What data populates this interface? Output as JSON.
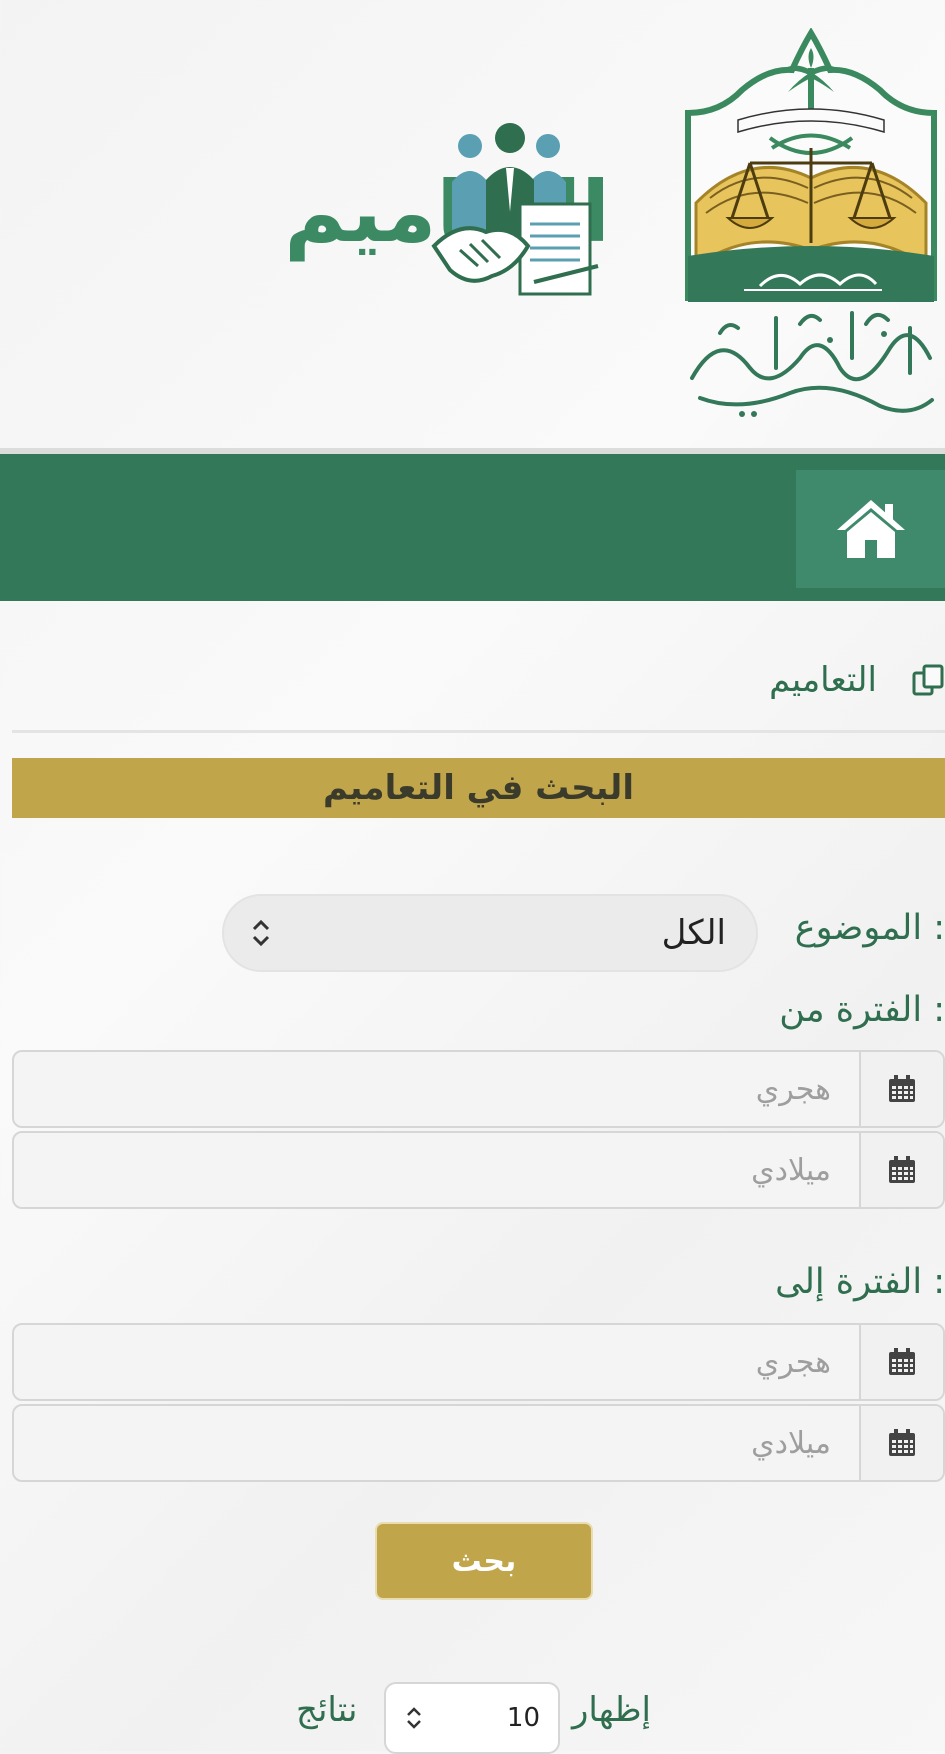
{
  "header": {
    "banner_title": "التعاميم",
    "emblem_alt": "وزارة العدل - مركز البحوث"
  },
  "nav": {
    "home_icon": "home-icon"
  },
  "section": {
    "title": "التعاميم",
    "title_icon": "copy-icon"
  },
  "search": {
    "banner_title": "البحث في التعاميم",
    "subject_label": "الموضوع :",
    "subject_value": "الكل",
    "period_from_label": "الفترة من :",
    "period_to_label": "الفترة إلى :",
    "hijri_placeholder": "هجري",
    "gregorian_placeholder": "ميلادي",
    "button_label": "بحث",
    "calendar_icon": "calendar-icon"
  },
  "pagination": {
    "show_prefix": "إظهار",
    "page_size": "10",
    "show_suffix": "نتائج"
  },
  "colors": {
    "primary_green": "#34785a",
    "home_green": "#3f8a6d",
    "gold": "#c1a54b"
  }
}
